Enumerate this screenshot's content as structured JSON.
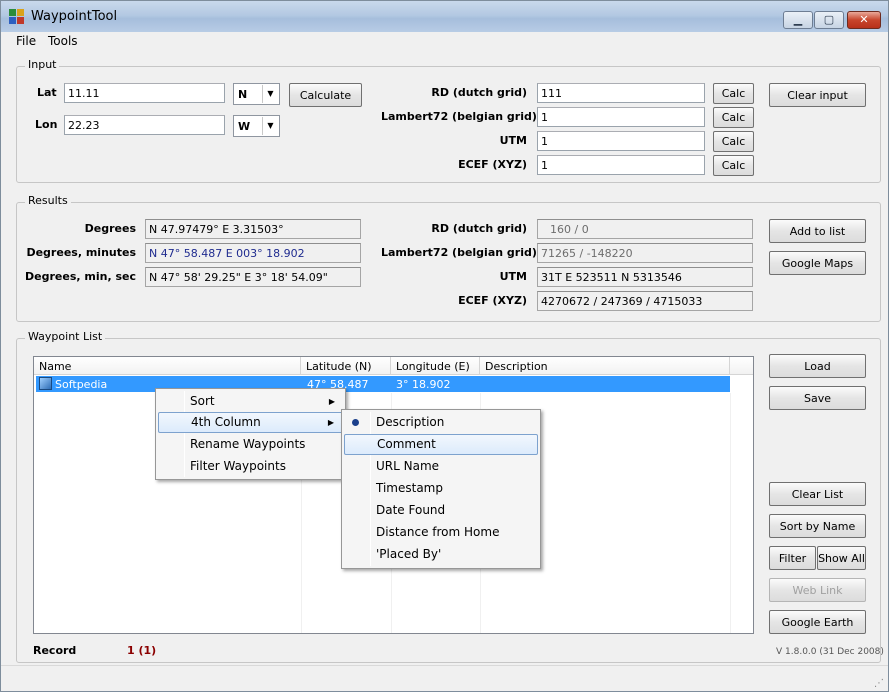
{
  "window": {
    "title": "WaypointTool",
    "min": "▁",
    "max": "▢",
    "close": "✕"
  },
  "menu": {
    "file": "File",
    "tools": "Tools"
  },
  "input": {
    "legend": "Input",
    "lat_label": "Lat",
    "lat_value": "11.11",
    "lat_hemi": "N",
    "lon_label": "Lon",
    "lon_value": "22.23",
    "lon_hemi": "W",
    "calculate": "Calculate",
    "rd_label": "RD (dutch grid)",
    "rd_value": "111",
    "lambert_label": "Lambert72 (belgian grid)",
    "lambert_value": "1",
    "utm_label": "UTM",
    "utm_value": "1",
    "ecef_label": "ECEF (XYZ)",
    "ecef_value": "1",
    "calc": "Calc",
    "clear_input": "Clear input"
  },
  "results": {
    "legend": "Results",
    "degrees_label": "Degrees",
    "degrees_value": "N 47.97479°  E 3.31503°",
    "dm_label": "Degrees, minutes",
    "dm_value": "N 47° 58.487   E 003° 18.902",
    "dms_label": "Degrees, min, sec",
    "dms_value": "N 47° 58' 29.25\"  E 3° 18' 54.09\"",
    "rd_label": "RD (dutch grid)",
    "rd_value": "160  /     0",
    "lambert_label": "Lambert72 (belgian grid)",
    "lambert_value": "71265 / -148220",
    "utm_label": "UTM",
    "utm_value": "31T  E 523511  N 5313546",
    "ecef_label": "ECEF (XYZ)",
    "ecef_value": "4270672 / 247369 / 4715033",
    "add_to_list": "Add to list",
    "google_maps": "Google Maps"
  },
  "waypoints": {
    "legend": "Waypoint List",
    "columns": [
      "Name",
      "Latitude (N)",
      "Longitude (E)",
      "Description"
    ],
    "rows": [
      {
        "name": "Softpedia",
        "lat": "47° 58.487",
        "lon": "3° 18.902",
        "desc": ""
      }
    ],
    "load": "Load",
    "save": "Save",
    "clear_list": "Clear List",
    "sort_by_name": "Sort by Name",
    "filter": "Filter",
    "show_all": "Show All",
    "web_link": "Web Link",
    "google_earth": "Google Earth",
    "record_label": "Record",
    "record_value": "1 (1)",
    "version": "V 1.8.0.0  (31 Dec 2008)"
  },
  "context_menu": {
    "items": [
      "Sort",
      "4th Column",
      "Rename Waypoints",
      "Filter Waypoints"
    ]
  },
  "submenu": {
    "items": [
      "Description",
      "Comment",
      "URL Name",
      "Timestamp",
      "Date Found",
      "Distance from Home",
      "'Placed By'"
    ]
  },
  "colors": {
    "selection": "#3399ff",
    "record_value": "#8b0000",
    "title_accent": "#b3c8e2"
  }
}
